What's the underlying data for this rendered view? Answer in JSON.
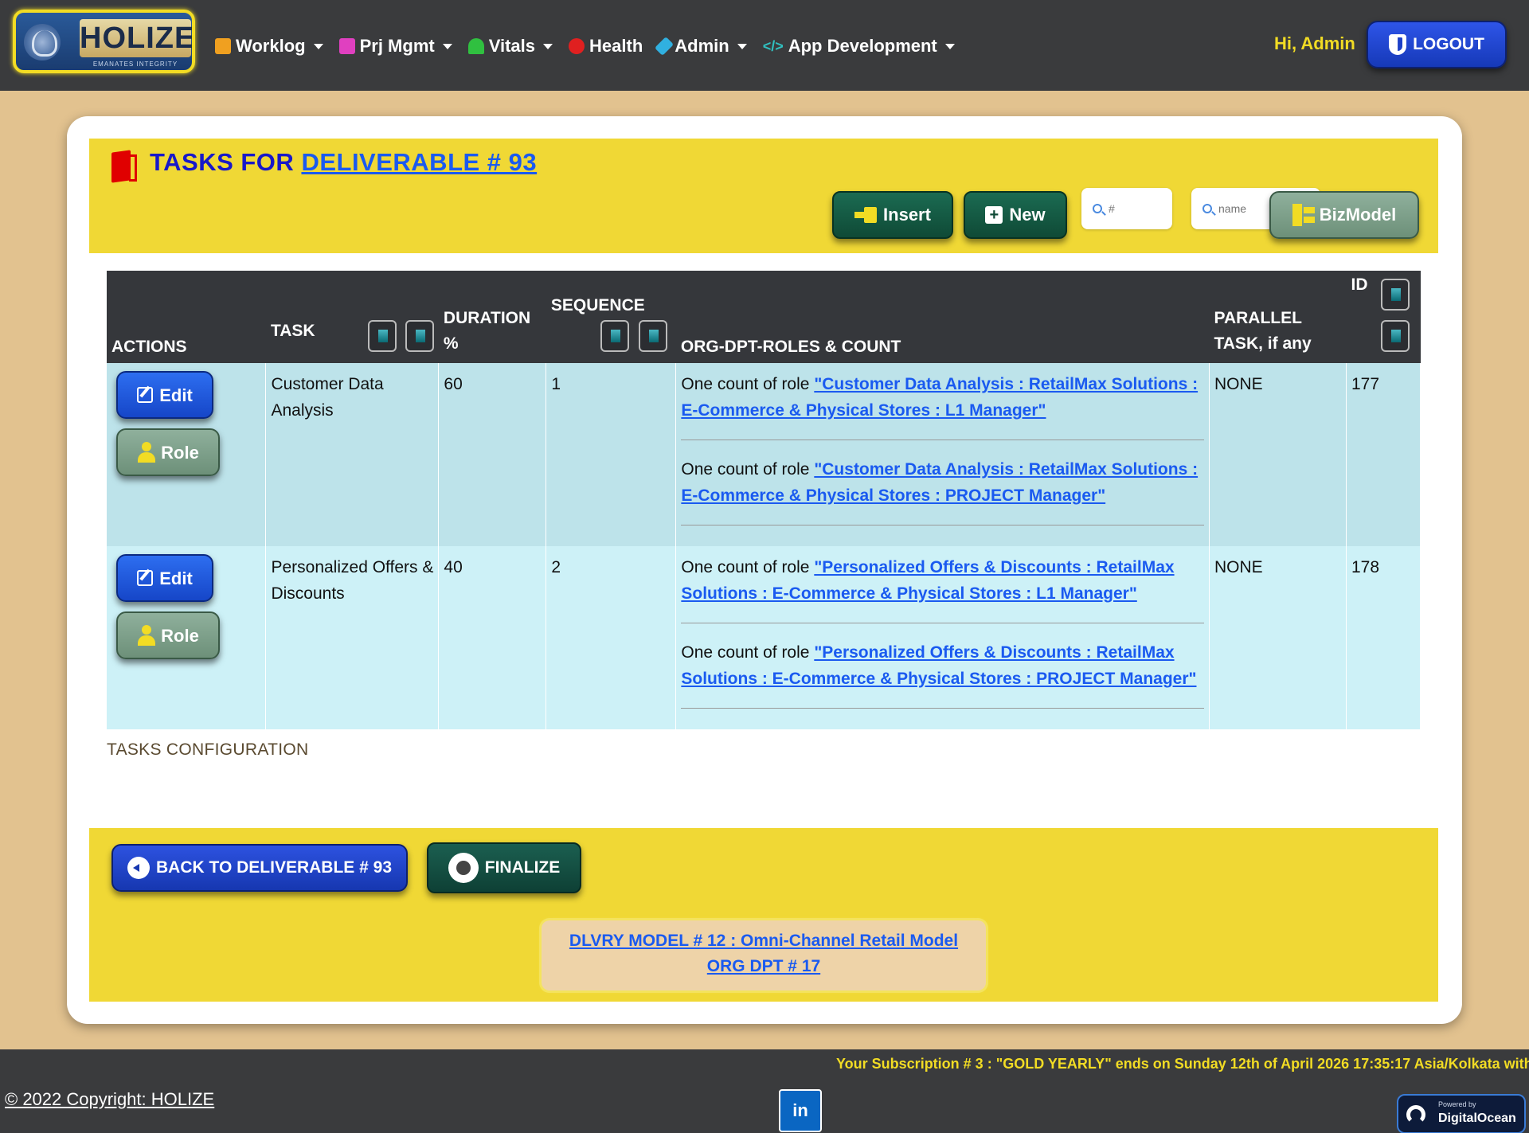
{
  "brand": {
    "name": "HOLIZE",
    "tagline": "EMANATES INTEGRITY"
  },
  "nav": {
    "items": [
      {
        "label": "Worklog",
        "icon": "briefcase-icon",
        "color": "#f0a020",
        "has_caret": true
      },
      {
        "label": "Prj Mgmt",
        "icon": "network-icon",
        "color": "#e040c0",
        "has_caret": true
      },
      {
        "label": "Vitals",
        "icon": "heartbeat-icon",
        "color": "#30c040",
        "has_caret": true
      },
      {
        "label": "Health",
        "icon": "stethoscope-icon",
        "color": "#e02020",
        "has_caret": false
      },
      {
        "label": "Admin",
        "icon": "tools-icon",
        "color": "#30b0e0",
        "has_caret": true
      },
      {
        "label": "App Development",
        "icon": "code-icon",
        "color": "#30c0c0",
        "has_caret": true
      }
    ],
    "greeting": "Hi, Admin",
    "logout_label": "LOGOUT"
  },
  "header": {
    "title_prefix": "TASKS FOR",
    "title_link": "DELIVERABLE # 93",
    "insert_label": "Insert",
    "new_label": "New",
    "search_id_placeholder": "#",
    "search_name_placeholder": "name",
    "bizmodel_label": "BizModel"
  },
  "table": {
    "columns": {
      "actions": "ACTIONS",
      "task": "TASK",
      "duration": "DURATION %",
      "sequence": "SEQUENCE",
      "roles": "ORG-DPT-ROLES & COUNT",
      "parallel": "PARALLEL TASK, if any",
      "id": "ID"
    },
    "edit_label": "Edit",
    "role_label": "Role",
    "role_prefix": "One count of role",
    "rows": [
      {
        "task": "Customer Data Analysis",
        "duration": "60",
        "sequence": "1",
        "roles": [
          "\"Customer Data Analysis : RetailMax Solutions : E-Commerce & Physical Stores : L1 Manager\"",
          "\"Customer Data Analysis : RetailMax Solutions : E-Commerce & Physical Stores : PROJECT Manager\""
        ],
        "parallel": "NONE",
        "id": "177"
      },
      {
        "task": "Personalized Offers & Discounts",
        "duration": "40",
        "sequence": "2",
        "roles": [
          "\"Personalized Offers & Discounts : RetailMax Solutions : E-Commerce & Physical Stores : L1 Manager\"",
          "\"Personalized Offers & Discounts : RetailMax Solutions : E-Commerce & Physical Stores : PROJECT Manager\""
        ],
        "parallel": "NONE",
        "id": "178"
      }
    ],
    "caption": "TASKS CONFIGURATION"
  },
  "footer_actions": {
    "back_label": "BACK TO DELIVERABLE # 93",
    "finalize_label": "FINALIZE",
    "model_line1": "DLVRY MODEL # 12 : Omni-Channel Retail Model",
    "model_line2": "ORG DPT # 17"
  },
  "footer": {
    "subscription": "Your Subscription # 3 : \"GOLD YEARLY\" ends on Sunday 12th of April 2026 17:35:17 Asia/Kolkata with g",
    "copyright": "© 2022 Copyright: HOLIZE",
    "linkedin": "in",
    "do_small": "Powered by",
    "do_big": "DigitalOcean"
  },
  "colors": {
    "navbar": "#3a3b3d",
    "page_bg": "#e2c28f",
    "band_yellow": "#f0d835",
    "link_blue": "#1a5af0",
    "title_blue": "#1818c9",
    "row_odd": "#bde3ea",
    "row_even": "#cdf1f7"
  }
}
